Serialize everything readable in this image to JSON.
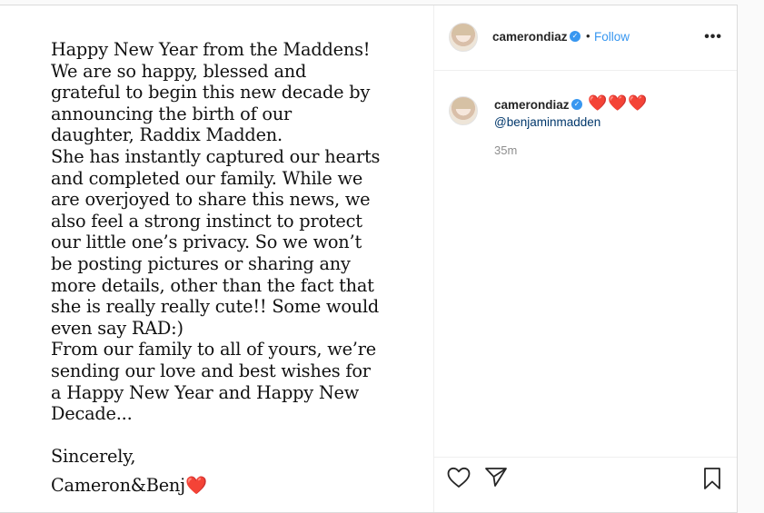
{
  "post": {
    "media_lines": [
      "Happy New Year from the Maddens!",
      "We are so happy, blessed and",
      "grateful to begin this new decade by",
      "announcing the birth of our",
      "daughter, Raddix Madden.",
      "She has instantly captured our hearts",
      "and completed our family. While we",
      "are overjoyed to share this news, we",
      "also feel a strong instinct to protect",
      "our little one’s privacy. So we won’t",
      "be posting pictures or sharing any",
      "more details, other than the fact that",
      "she is really really cute!! Some would",
      "even say RAD:)",
      "From our family to all of yours, we’re",
      "sending our love and best wishes for",
      "a Happy New Year and Happy New",
      "Decade..."
    ],
    "signoff": "Sincerely,",
    "signature": "Cameron&Benj",
    "signature_heart": "❤️"
  },
  "header": {
    "username": "camerondiaz",
    "verified_icon": "verified-badge-icon",
    "separator": "•",
    "follow_label": "Follow",
    "more_label": "•••"
  },
  "caption": {
    "username": "camerondiaz",
    "hearts": "❤️❤️❤️",
    "mention": "@benjaminmadden",
    "time": "35m"
  },
  "actions": {
    "like_icon": "heart-outline-icon",
    "share_icon": "paper-plane-icon",
    "save_icon": "bookmark-icon"
  },
  "colors": {
    "accent": "#3897f0",
    "heart": "#e0245e",
    "mention": "#00376b",
    "muted": "#8e8e8e"
  }
}
